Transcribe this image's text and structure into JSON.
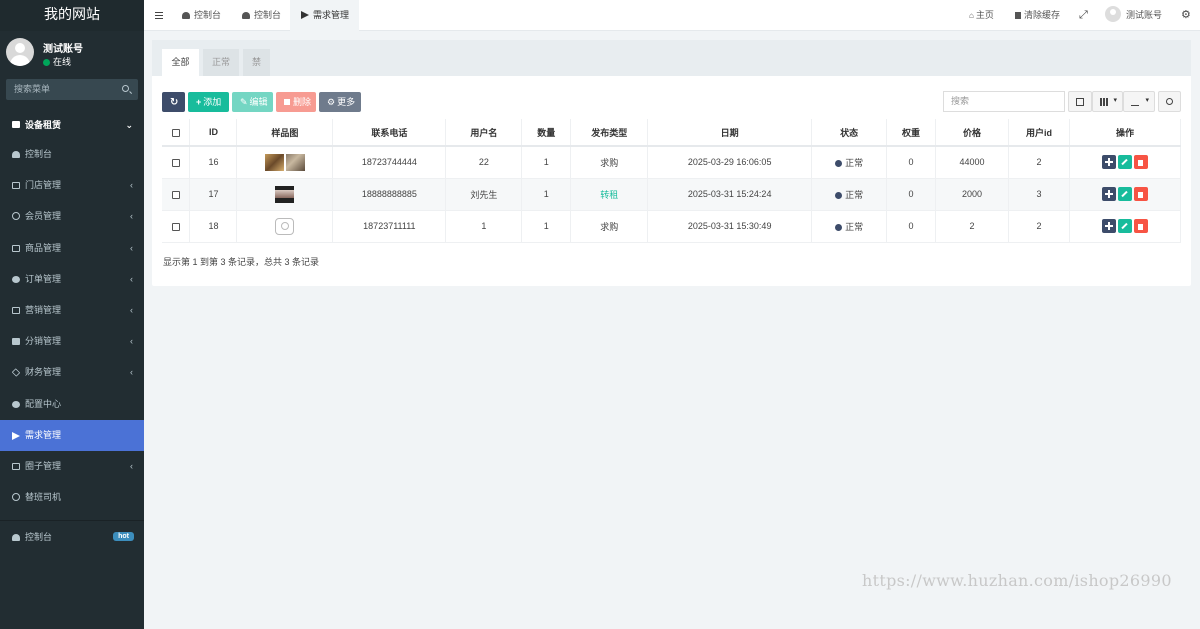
{
  "app": {
    "title": "我的网站"
  },
  "user": {
    "name": "测试账号",
    "status": "在线"
  },
  "sidebar": {
    "search_placeholder": "搜索菜单",
    "section": "设备租赁",
    "items": [
      {
        "label": "控制台",
        "icon": "dashboard-icon",
        "has_children": false
      },
      {
        "label": "门店管理",
        "icon": "store-icon",
        "has_children": true
      },
      {
        "label": "会员管理",
        "icon": "user-icon",
        "has_children": true
      },
      {
        "label": "商品管理",
        "icon": "goods-icon",
        "has_children": true
      },
      {
        "label": "订单管理",
        "icon": "order-icon",
        "has_children": true
      },
      {
        "label": "营销管理",
        "icon": "marketing-icon",
        "has_children": true
      },
      {
        "label": "分销管理",
        "icon": "sitemap-icon",
        "has_children": true
      },
      {
        "label": "财务管理",
        "icon": "diamond-icon",
        "has_children": true
      },
      {
        "label": "配置中心",
        "icon": "gear-icon",
        "has_children": false
      },
      {
        "label": "需求管理",
        "icon": "paper-plane-icon",
        "has_children": false,
        "active": true
      },
      {
        "label": "圈子管理",
        "icon": "rss-icon",
        "has_children": true
      },
      {
        "label": "替班司机",
        "icon": "circle-icon",
        "has_children": false
      }
    ],
    "bottom_item": {
      "label": "控制台",
      "badge": "hot"
    }
  },
  "topbar": {
    "tabs": [
      "控制台",
      "控制台",
      "需求管理"
    ],
    "home": "主页",
    "clear_cache": "清除缓存",
    "account": "测试账号"
  },
  "panel": {
    "tabs": [
      "全部",
      "正常",
      "禁"
    ],
    "buttons": {
      "add": "添加",
      "edit": "编辑",
      "delete": "删除",
      "more": "更多"
    },
    "search_placeholder": "搜索"
  },
  "table": {
    "headers": [
      "ID",
      "样品图",
      "联系电话",
      "用户名",
      "数量",
      "发布类型",
      "日期",
      "状态",
      "权重",
      "价格",
      "用户id",
      "操作"
    ],
    "rows": [
      {
        "id": "16",
        "phone": "18723744444",
        "username": "22",
        "qty": "1",
        "type": "求购",
        "date": "2025-03-29 16:06:05",
        "status": "正常",
        "weight": "0",
        "price": "44000",
        "user_id": "2"
      },
      {
        "id": "17",
        "phone": "18888888885",
        "username": "刘先生",
        "qty": "1",
        "type": "转租",
        "date": "2025-03-31 15:24:24",
        "status": "正常",
        "weight": "0",
        "price": "2000",
        "user_id": "3"
      },
      {
        "id": "18",
        "phone": "18723711111",
        "username": "1",
        "qty": "1",
        "type": "求购",
        "date": "2025-03-31 15:30:49",
        "status": "正常",
        "weight": "0",
        "price": "2",
        "user_id": "2"
      }
    ],
    "summary": "显示第 1 到第 3 条记录，总共 3 条记录"
  },
  "watermark": "https://www.huzhan.com/ishop26990",
  "colors": {
    "sidebar_bg": "#222d32",
    "active_menu": "#4b72d6",
    "success": "#18bc9c",
    "danger": "#f75444",
    "primary_dark": "#3d4c6a"
  }
}
